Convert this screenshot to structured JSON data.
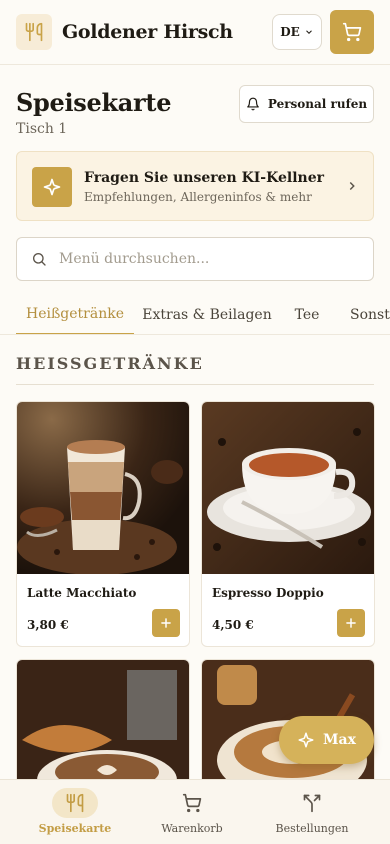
{
  "header": {
    "brand": "Goldener Hirsch",
    "language": "DE"
  },
  "page": {
    "title": "Speisekarte",
    "table": "Tisch 1",
    "call_staff": "Personal rufen"
  },
  "ai_card": {
    "title": "Fragen Sie unseren KI-Kellner",
    "subtitle": "Empfehlungen, Allergeninfos & mehr"
  },
  "search": {
    "placeholder": "Menü durchsuchen..."
  },
  "tabs": [
    {
      "label": "Heißgetränke",
      "active": true
    },
    {
      "label": "Extras & Beilagen",
      "active": false
    },
    {
      "label": "Tee",
      "active": false
    },
    {
      "label": "Sonsti",
      "active": false
    }
  ],
  "section": {
    "title": "HEISSGETRÄNKE"
  },
  "products": [
    {
      "name": "Latte Macchiato",
      "price": "3,80 €"
    },
    {
      "name": "Espresso Doppio",
      "price": "4,50 €"
    },
    {
      "name": "",
      "price": ""
    },
    {
      "name": "",
      "price": ""
    }
  ],
  "assistant_button": {
    "label": "Max"
  },
  "bottom_nav": [
    {
      "label": "Speisekarte",
      "icon": "utensils-icon",
      "active": true
    },
    {
      "label": "Warenkorb",
      "icon": "cart-icon",
      "active": false
    },
    {
      "label": "Bestellungen",
      "icon": "orders-icon",
      "active": false
    }
  ],
  "colors": {
    "accent": "#c9a348",
    "background": "#fdfbf6",
    "text": "#1f1b14"
  }
}
